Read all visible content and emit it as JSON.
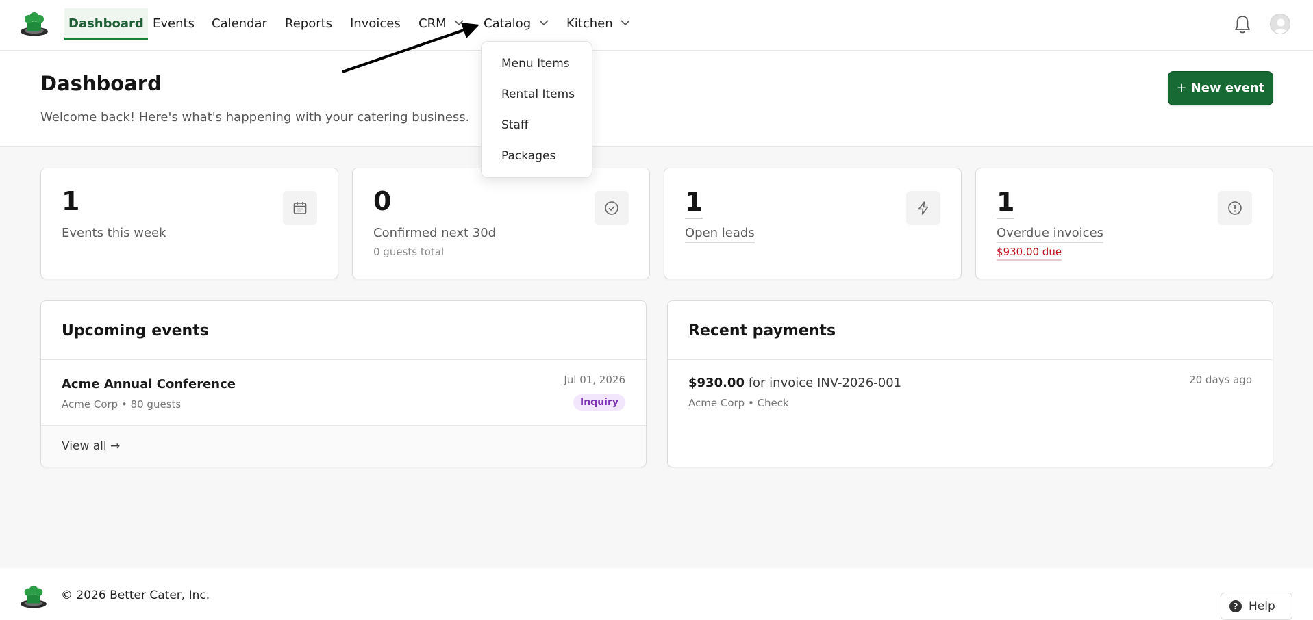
{
  "nav": {
    "items": [
      {
        "label": "Dashboard"
      },
      {
        "label": "Events"
      },
      {
        "label": "Calendar"
      },
      {
        "label": "Reports"
      },
      {
        "label": "Invoices"
      },
      {
        "label": "CRM"
      },
      {
        "label": "Catalog"
      },
      {
        "label": "Kitchen"
      }
    ],
    "active": "Dashboard"
  },
  "catalog_menu": {
    "items": [
      {
        "label": "Menu Items"
      },
      {
        "label": "Rental Items"
      },
      {
        "label": "Staff"
      },
      {
        "label": "Packages"
      }
    ]
  },
  "header": {
    "title": "Dashboard",
    "subtitle": "Welcome back! Here's what's happening with your catering business.",
    "new_event_label": "New event",
    "new_event_icon": "+"
  },
  "stats": [
    {
      "value": "1",
      "label": "Events this week",
      "sub": "",
      "icon": "calendar-icon"
    },
    {
      "value": "0",
      "label": "Confirmed next 30d",
      "sub": "0 guests total",
      "icon": "check-circle-icon"
    },
    {
      "value": "1",
      "label": "Open leads",
      "sub": "",
      "icon": "lightning-icon"
    },
    {
      "value": "1",
      "label": "Overdue invoices",
      "sub": "$930.00 due",
      "icon": "alert-circle-icon"
    }
  ],
  "upcoming": {
    "title": "Upcoming events",
    "events": [
      {
        "name": "Acme Annual Conference",
        "meta": "Acme Corp • 80 guests",
        "date": "Jul 01, 2026",
        "status": "Inquiry"
      }
    ],
    "view_all": "View all →"
  },
  "payments": {
    "title": "Recent payments",
    "items": [
      {
        "amount": "$930.00",
        "text": " for invoice INV-2026-001",
        "meta": "Acme Corp • Check",
        "time": "20 days ago"
      }
    ]
  },
  "footer": {
    "copyright": "© 2026 Better Cater, Inc.",
    "help_label": "Help"
  },
  "colors": {
    "brand_green": "#176a33",
    "danger": "#c0121f",
    "badge_bg": "#f1e6fb",
    "badge_text": "#7a2fb4"
  }
}
